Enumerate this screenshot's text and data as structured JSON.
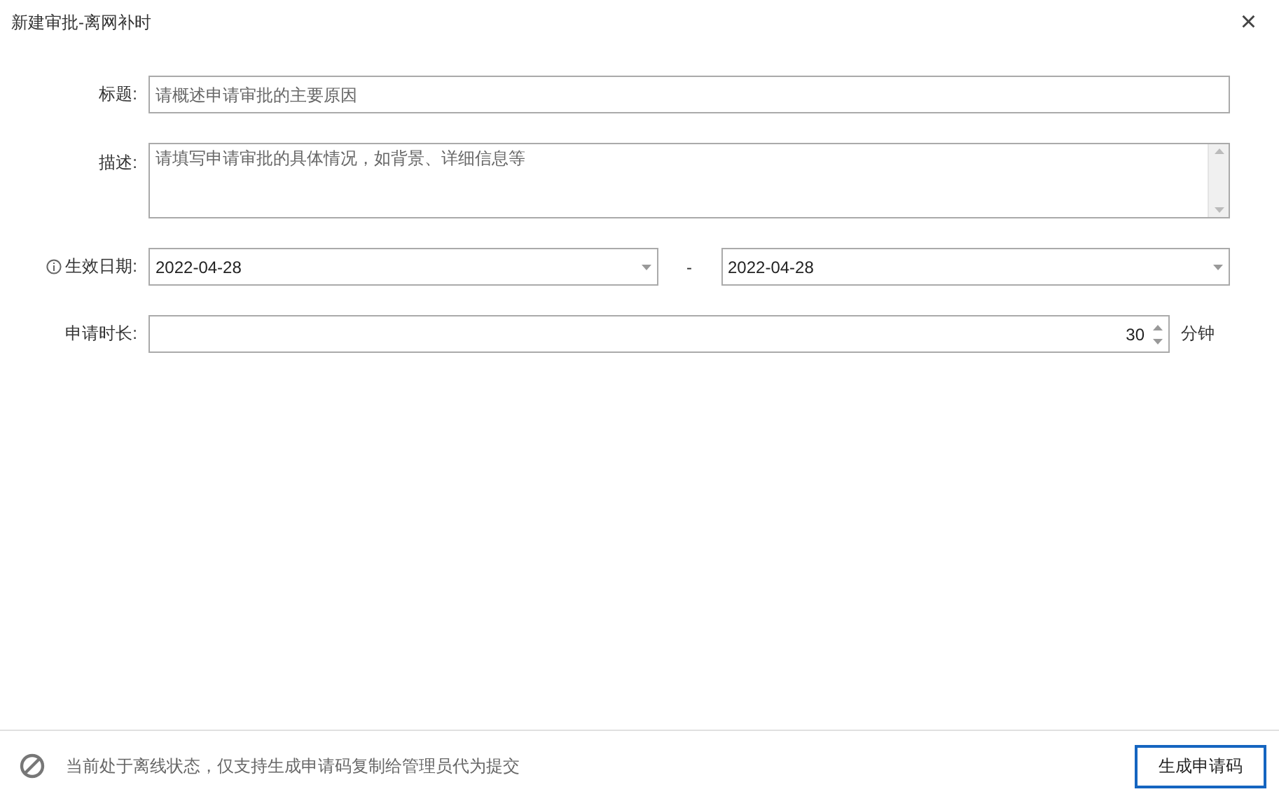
{
  "window": {
    "title": "新建审批-离网补时",
    "close": "×"
  },
  "form": [
    {
      "kind": "text",
      "label": "标题:",
      "placeholder": "请概述申请审批的主要原因"
    },
    {
      "kind": "textarea",
      "label": "描述:",
      "placeholder": "请填写申请审批的具体情况，如背景、详细信息等"
    },
    {
      "kind": "daterange",
      "label": "生效日期:",
      "info": true,
      "from": "2022-04-28",
      "separator": "-",
      "to": "2022-04-28"
    },
    {
      "kind": "number",
      "label": "申请时长:",
      "value": "30",
      "unit": "分钟"
    }
  ],
  "footer": {
    "notice": "当前处于离线状态，仅支持生成申请码复制给管理员代为提交",
    "button": "生成申请码"
  }
}
